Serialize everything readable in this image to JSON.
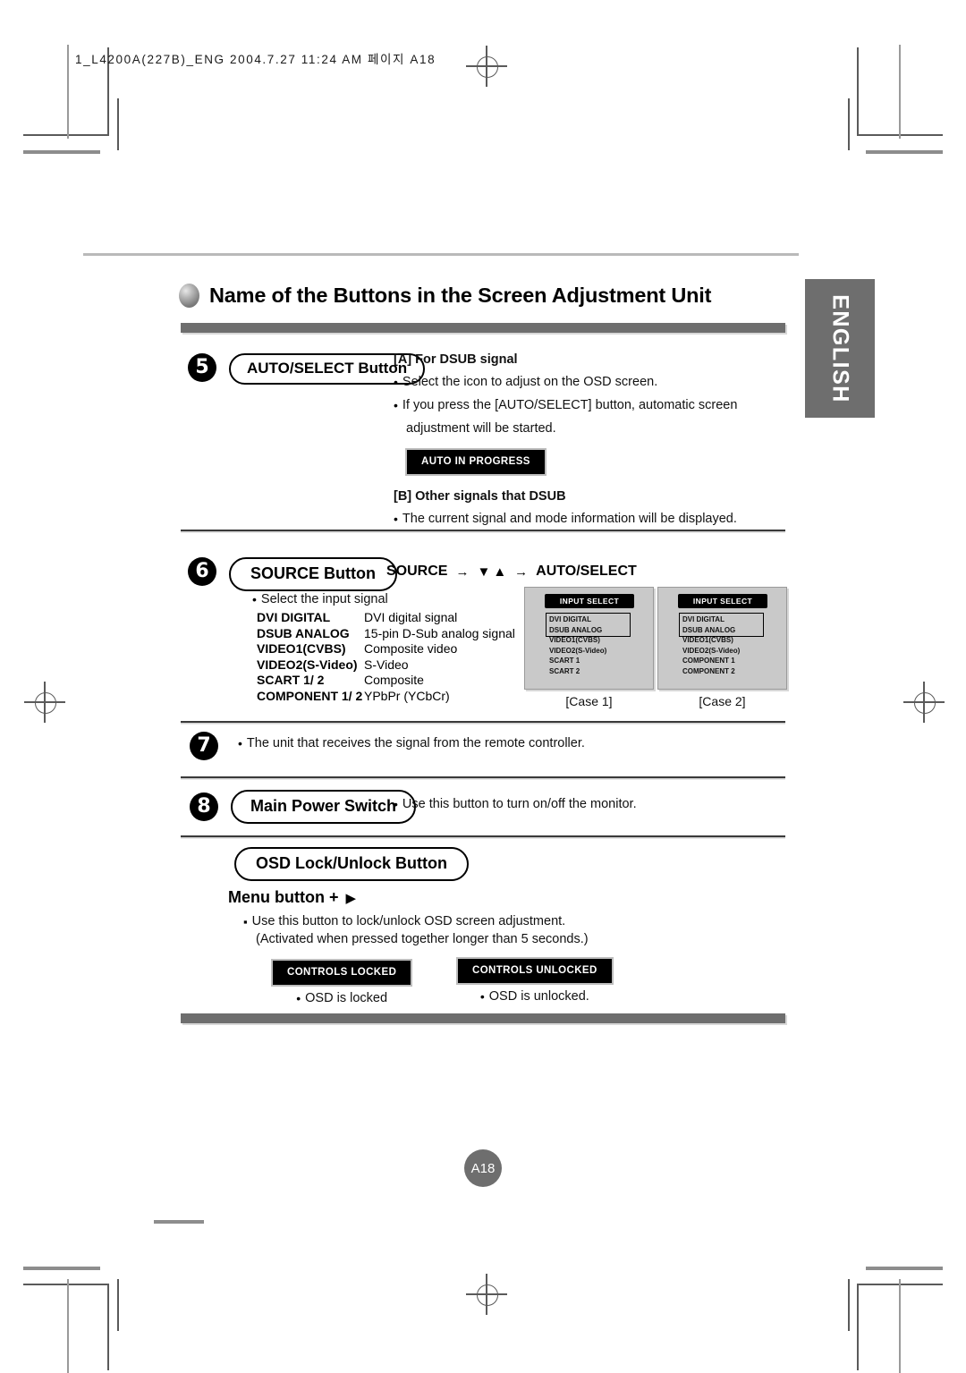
{
  "slug": "1_L4200A(227B)_ENG  2004.7.27  11:24 AM 페이지  A18",
  "lang_tab": "ENGLISH",
  "page_number": "A18",
  "title": "Name of the Buttons in the Screen Adjustment Unit",
  "sections": [
    {
      "number": "5",
      "pill": "AUTO/SELECT Button",
      "heading_a": "[A] For DSUB signal",
      "bullets_a": [
        "Select the icon to adjust on the OSD screen.",
        "If you press the [AUTO/SELECT] button, automatic screen",
        "adjustment will be started."
      ],
      "chip": "AUTO IN PROGRESS",
      "heading_b": "[B] Other signals that DSUB",
      "bullets_b": [
        "The current signal and mode information will be displayed."
      ]
    },
    {
      "number": "6",
      "pill": "SOURCE Button",
      "flow": {
        "step1": "SOURCE",
        "arrow1": "→",
        "step2_down": "▼",
        "step2_up": "▲",
        "arrow2": "→",
        "step3": "AUTO/SELECT"
      },
      "intro": "Select the input signal",
      "signal_table": [
        {
          "name": "DVI DIGITAL",
          "desc": "DVI digital signal"
        },
        {
          "name": "DSUB ANALOG",
          "desc": "15-pin D-Sub analog signal"
        },
        {
          "name": "VIDEO1(CVBS)",
          "desc": "Composite video"
        },
        {
          "name": "VIDEO2(S-Video)",
          "desc": "S-Video"
        },
        {
          "name": "SCART 1/ 2",
          "desc": "Composite"
        },
        {
          "name": "COMPONENT 1/ 2",
          "desc": "YPbPr (YCbCr)"
        }
      ],
      "osd_cases": [
        {
          "header": "INPUT SELECT",
          "items": [
            "DVI DIGITAL",
            "DSUB ANALOG",
            "VIDEO1(CVBS)",
            "VIDEO2(S-Video)",
            "SCART 1",
            "SCART 2"
          ],
          "caption": "[Case 1]"
        },
        {
          "header": "INPUT SELECT",
          "items": [
            "DVI DIGITAL",
            "DSUB ANALOG",
            "VIDEO1(CVBS)",
            "VIDEO2(S-Video)",
            "COMPONENT 1",
            "COMPONENT 2"
          ],
          "caption": "[Case 2]"
        }
      ]
    },
    {
      "number": "7",
      "bullet": "The unit that receives the signal from the remote controller."
    },
    {
      "number": "8",
      "pill": "Main Power Switch",
      "bullet": "Use this button to turn on/off the monitor."
    },
    {
      "pill": "OSD Lock/Unlock Button",
      "menu_line_text": "Menu button  +",
      "menu_line_arrow": "▶",
      "bullets": [
        "Use this button to lock/unlock OSD screen adjustment.",
        "(Activated when pressed together longer than 5 seconds.)"
      ],
      "chips": [
        {
          "label": "CONTROLS LOCKED",
          "caption": "OSD is locked"
        },
        {
          "label": "CONTROLS UNLOCKED",
          "caption": "OSD is unlocked."
        }
      ]
    }
  ],
  "colors": {
    "bar_gray": "#6e6e6e",
    "rule_gray": "#b9b9b9",
    "osd_bg": "#c9c9c9",
    "chip_bg": "#000000"
  }
}
